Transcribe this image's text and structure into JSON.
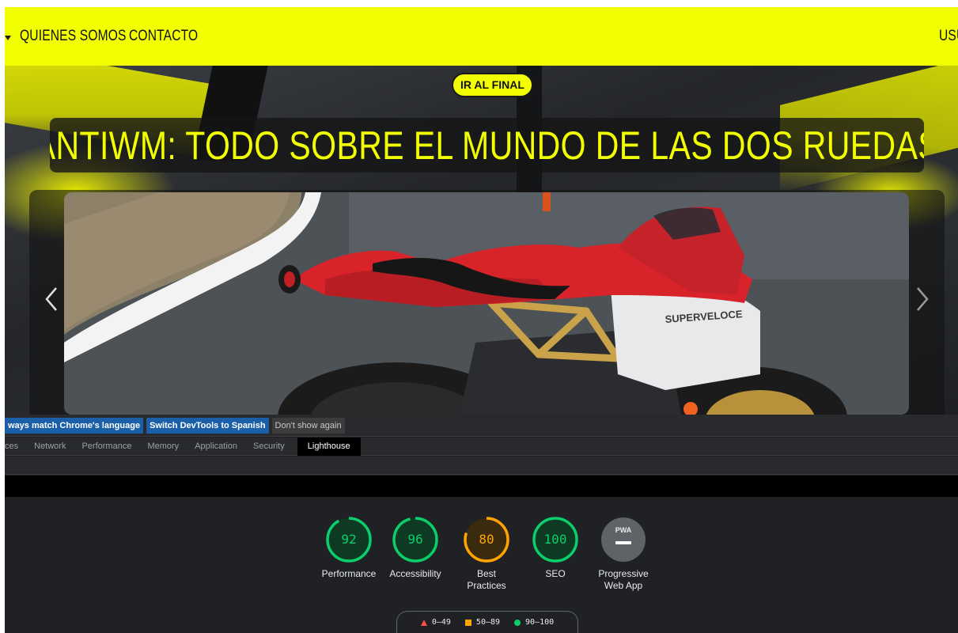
{
  "nav": {
    "links": [
      "QUIENES SOMOS",
      "CONTACTO",
      "USU"
    ]
  },
  "hero": {
    "go_end_button": "IR AL FINAL",
    "title": "ANTIWM: TODO SOBRE EL MUNDO DE LAS DOS RUEDAS",
    "bike_text": "SUPERVELOCE"
  },
  "devtools": {
    "infobar": {
      "match_language": "ways match Chrome's language",
      "switch_language": "Switch DevTools to Spanish",
      "dont_show": "Don't show again"
    },
    "tabs": [
      "ces",
      "Network",
      "Performance",
      "Memory",
      "Application",
      "Security",
      "Lighthouse"
    ],
    "active_tab": "Lighthouse",
    "gauges": [
      {
        "label": "Performance",
        "score": "92",
        "value": 92,
        "color": "#0cce6b"
      },
      {
        "label": "Accessibility",
        "score": "96",
        "value": 96,
        "color": "#0cce6b"
      },
      {
        "label": "Best Practices",
        "score": "80",
        "value": 80,
        "color": "#ffa400"
      },
      {
        "label": "SEO",
        "score": "100",
        "value": 100,
        "color": "#0cce6b"
      }
    ],
    "pwa": {
      "badge": "PWA",
      "label": "Progressive Web App"
    },
    "legend": {
      "fail": "0–49",
      "average": "50–89",
      "pass": "90–100"
    }
  }
}
